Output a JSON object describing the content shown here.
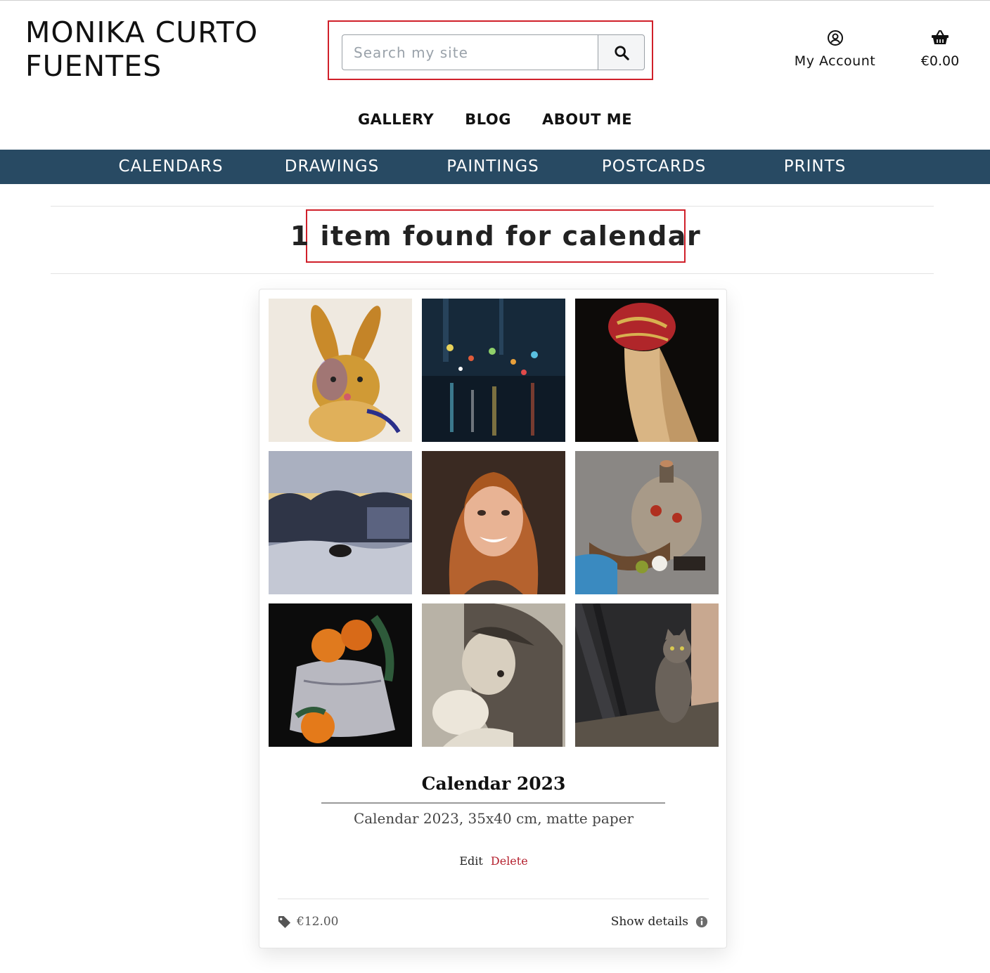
{
  "site": {
    "brand_line1": "MONIKA CURTO",
    "brand_line2": "FUENTES"
  },
  "search": {
    "placeholder": "Search my site",
    "value": ""
  },
  "header": {
    "account_label": "My Account",
    "account_icon": "user-circle-icon",
    "cart_total": "€0.00",
    "cart_icon": "basket-icon"
  },
  "main_nav": [
    {
      "label": "GALLERY"
    },
    {
      "label": "BLOG"
    },
    {
      "label": "ABOUT ME"
    }
  ],
  "category_nav": [
    {
      "label": "CALENDARS"
    },
    {
      "label": "DRAWINGS"
    },
    {
      "label": "PAINTINGS"
    },
    {
      "label": "POSTCARDS"
    },
    {
      "label": "PRINTS"
    }
  ],
  "results": {
    "prefix": "1 item found for",
    "query": "calendar"
  },
  "product": {
    "images": [
      {
        "icon": "hare-painting"
      },
      {
        "icon": "night-street-painting"
      },
      {
        "icon": "woman-headscarf-painting"
      },
      {
        "icon": "winter-landscape-painting"
      },
      {
        "icon": "artist-portrait-photo"
      },
      {
        "icon": "still-life-jug-painting"
      },
      {
        "icon": "oranges-bag-painting"
      },
      {
        "icon": "mother-baby-drawing"
      },
      {
        "icon": "cat-window-painting"
      }
    ],
    "title": "Calendar 2023",
    "description": "Calendar 2023, 35x40 cm, matte paper",
    "edit_label": "Edit",
    "delete_label": "Delete",
    "price": "€12.00",
    "price_icon": "tag-icon",
    "details_label": "Show details",
    "details_icon": "info-circle-icon"
  },
  "colors": {
    "category_bar": "#284a63",
    "highlight_border": "#d0202a",
    "delete_link": "#b5222f"
  }
}
